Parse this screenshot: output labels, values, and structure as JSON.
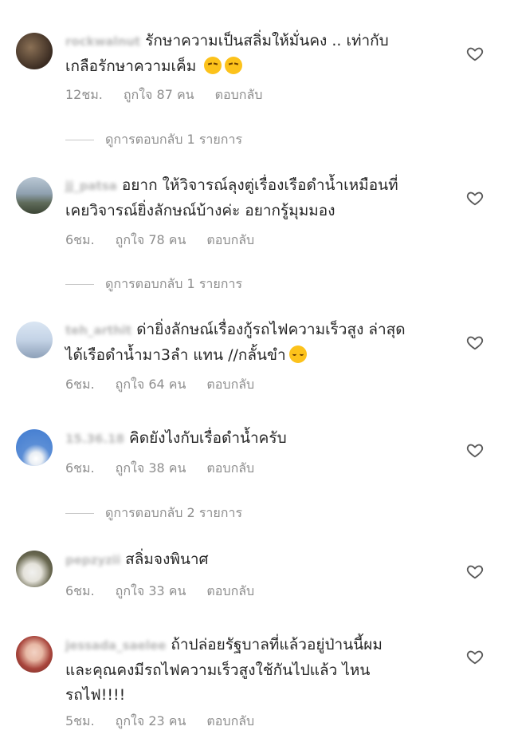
{
  "comments": [
    {
      "username": "rockwalnut",
      "text_line1": "รักษาความเป็นสลิ่มให้มั่นคง .. เท่ากับ",
      "text_line2": "เกลือรักษาความเค็ม",
      "time": "12ชม.",
      "likes": "ถูกใจ 87 คน",
      "reply": "ตอบกลับ",
      "view_replies": "ดูการตอบกลับ 1 รายการ"
    },
    {
      "username": "jj_patsa",
      "text_line1": "อยาก ให้วิจารณ์ลุงตู่เรื่องเรือดำน้ำเหมือนที่",
      "text_line2": "เคยวิจารณ์ยิ่งลักษณ์บ้างค่ะ อยากรู้มุมมอง",
      "time": "6ชม.",
      "likes": "ถูกใจ 78 คน",
      "reply": "ตอบกลับ",
      "view_replies": "ดูการตอบกลับ 1 รายการ"
    },
    {
      "username": "teh_arthit",
      "text_line1": "ด่ายิ่งลักษณ์เรื่องกู้รถไฟความเร็วสูง ล่าสุด",
      "text_line2": "ได้เรือดำน้ำมา3ลำ แทน //กลั้นขำ",
      "time": "6ชม.",
      "likes": "ถูกใจ 64 คน",
      "reply": "ตอบกลับ"
    },
    {
      "username": "15.36.18",
      "text_line1": "คิดยังไงกับเรื่อดำน้ำครับ",
      "time": "6ชม.",
      "likes": "ถูกใจ 38 คน",
      "reply": "ตอบกลับ",
      "view_replies": "ดูการตอบกลับ 2 รายการ"
    },
    {
      "username": "pepzyzii",
      "text_line1": "สลิ่มจงพินาศ",
      "time": "6ชม.",
      "likes": "ถูกใจ 33 คน",
      "reply": "ตอบกลับ"
    },
    {
      "username": "jessada_saelee",
      "text_line1": "ถ้าปล่อยรัฐบาลที่แล้วอยู่ป่านนี้ผม",
      "text_line2": "และคุณคงมีรถไฟความเร็วสูงใช้กันไปแล้ว ไหน",
      "text_line3": "รถไฟ!!!!",
      "time": "5ชม.",
      "likes": "ถูกใจ 23 คน",
      "reply": "ตอบกลับ"
    }
  ],
  "icons": {
    "like": "heart-outline-icon",
    "sad_emoji": "disappointed-face-emoji",
    "relieved_emoji": "relieved-face-emoji"
  },
  "colors": {
    "text": "#262626",
    "meta": "#8e8e8e",
    "username_blurred": "#b8b8b8"
  }
}
